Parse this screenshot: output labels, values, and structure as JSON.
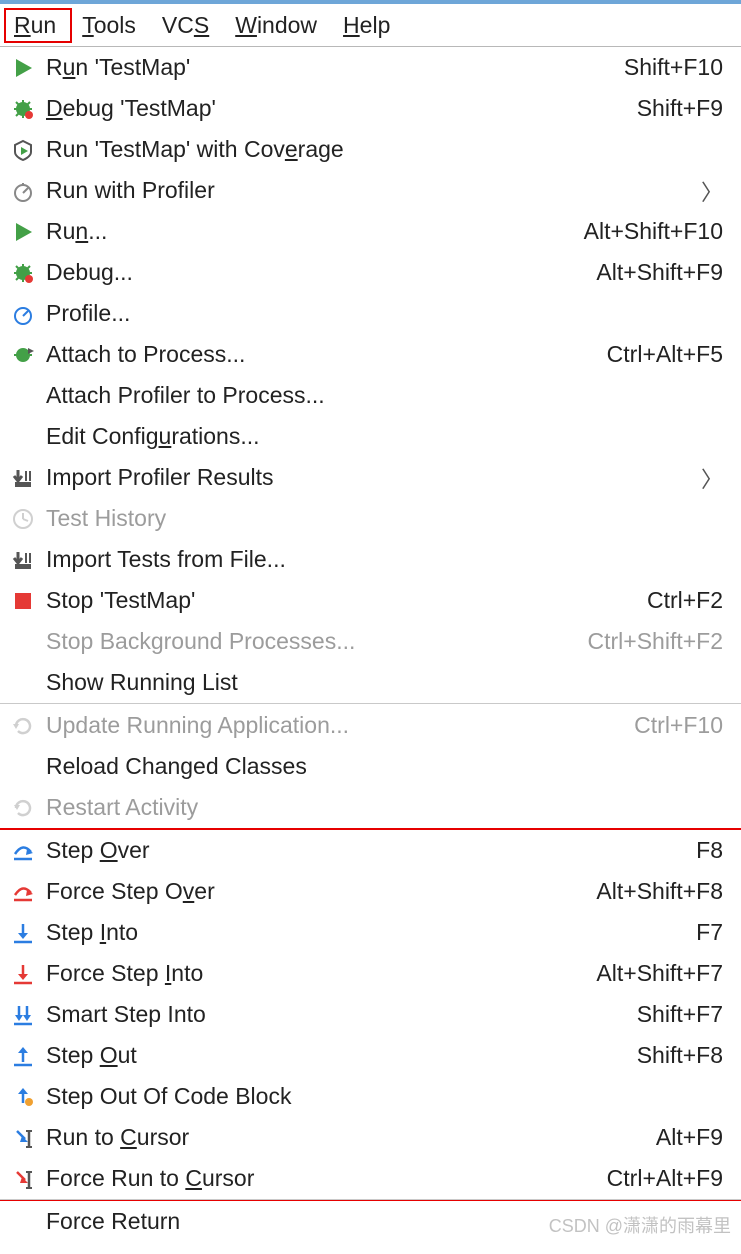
{
  "menubar": {
    "items": [
      {
        "label": "Run",
        "mnemonic_index": 0,
        "selected": true
      },
      {
        "label": "Tools",
        "mnemonic_index": 0
      },
      {
        "label": "VCS",
        "mnemonic_index": 2
      },
      {
        "label": "Window",
        "mnemonic_index": 0
      },
      {
        "label": "Help",
        "mnemonic_index": 0
      }
    ]
  },
  "menu": {
    "groups": [
      [
        {
          "icon": "run-icon",
          "label": "Run 'TestMap'",
          "shortcut": "Shift+F10",
          "m": [
            1
          ]
        },
        {
          "icon": "debug-icon",
          "label": "Debug 'TestMap'",
          "shortcut": "Shift+F9",
          "m": [
            0
          ]
        },
        {
          "icon": "coverage-icon",
          "label": "Run 'TestMap' with Coverage",
          "shortcut": "",
          "m": [
            22
          ]
        },
        {
          "icon": "profiler-icon",
          "label": "Run with Profiler",
          "shortcut": "",
          "submenu": true
        },
        {
          "icon": "run-icon",
          "label": "Run...",
          "shortcut": "Alt+Shift+F10",
          "m": [
            2
          ]
        },
        {
          "icon": "debug-icon",
          "label": "Debug...",
          "shortcut": "Alt+Shift+F9"
        },
        {
          "icon": "profiler2-icon",
          "label": "Profile..."
        },
        {
          "icon": "attach-icon",
          "label": "Attach to Process...",
          "shortcut": "Ctrl+Alt+F5"
        },
        {
          "icon": "",
          "label": "Attach Profiler to Process..."
        },
        {
          "icon": "",
          "label": "Edit Configurations...",
          "m": [
            11
          ]
        },
        {
          "icon": "import-icon",
          "label": "Import Profiler Results",
          "submenu": true
        },
        {
          "icon": "clock-icon",
          "label": "Test History",
          "disabled": true
        },
        {
          "icon": "import-icon",
          "label": "Import Tests from File..."
        },
        {
          "icon": "stop-icon",
          "label": "Stop 'TestMap'",
          "shortcut": "Ctrl+F2"
        },
        {
          "icon": "",
          "label": "Stop Background Processes...",
          "shortcut": "Ctrl+Shift+F2",
          "disabled": true
        },
        {
          "icon": "",
          "label": "Show Running List"
        }
      ],
      [
        {
          "icon": "refresh-icon",
          "label": "Update Running Application...",
          "shortcut": "Ctrl+F10",
          "disabled": true
        },
        {
          "icon": "",
          "label": "Reload Changed Classes"
        },
        {
          "icon": "restart-icon",
          "label": "Restart Activity",
          "disabled": true
        }
      ],
      [
        {
          "icon": "step-over-icon",
          "label": "Step Over",
          "shortcut": "F8",
          "m": [
            5
          ]
        },
        {
          "icon": "force-step-over-icon",
          "label": "Force Step Over",
          "shortcut": "Alt+Shift+F8",
          "m": [
            12
          ]
        },
        {
          "icon": "step-into-icon",
          "label": "Step Into",
          "shortcut": "F7",
          "m": [
            5
          ]
        },
        {
          "icon": "force-step-into-icon",
          "label": "Force Step Into",
          "shortcut": "Alt+Shift+F7",
          "m": [
            11
          ]
        },
        {
          "icon": "smart-step-into-icon",
          "label": "Smart Step Into",
          "shortcut": "Shift+F7"
        },
        {
          "icon": "step-out-icon",
          "label": "Step Out",
          "shortcut": "Shift+F8",
          "m": [
            5
          ]
        },
        {
          "icon": "step-out-block-icon",
          "label": "Step Out Of Code Block"
        },
        {
          "icon": "run-to-cursor-icon",
          "label": "Run to Cursor",
          "shortcut": "Alt+F9",
          "m": [
            7
          ]
        },
        {
          "icon": "force-run-cursor-icon",
          "label": "Force Run to Cursor",
          "shortcut": "Ctrl+Alt+F9",
          "m": [
            13
          ]
        }
      ],
      [
        {
          "icon": "",
          "label": "Force Return"
        }
      ]
    ],
    "highlight_group": 2
  },
  "watermark": "CSDN @潇潇的雨幕里"
}
